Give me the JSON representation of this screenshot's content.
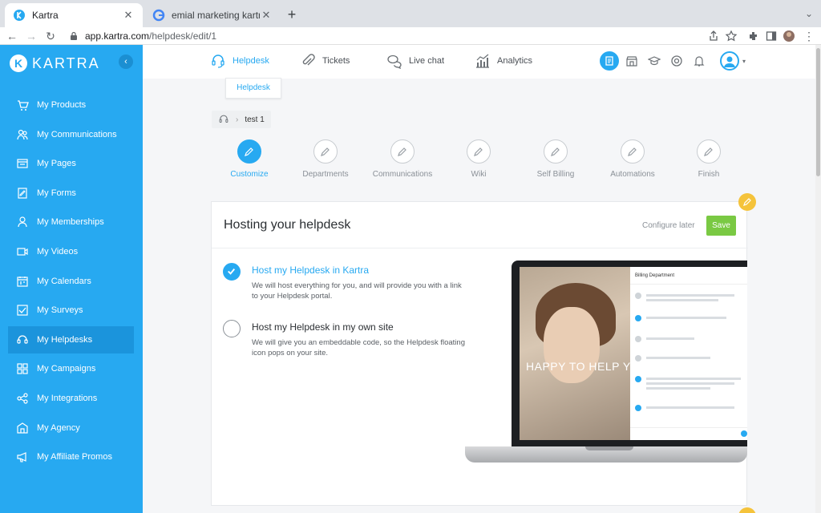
{
  "browser": {
    "tabs": [
      {
        "title": "Kartra",
        "favicon": "kartra-icon"
      },
      {
        "title": "emial marketing kartra - Googl",
        "favicon": "google-icon"
      }
    ],
    "new_tab_label": "+",
    "address": {
      "host": "app.kartra.com",
      "path": "/helpdesk/edit/1"
    }
  },
  "sidebar": {
    "brand": "KARTRA",
    "items": [
      {
        "label": "My Products",
        "icon": "cart-icon"
      },
      {
        "label": "My Communications",
        "icon": "people-icon"
      },
      {
        "label": "My Pages",
        "icon": "pages-icon"
      },
      {
        "label": "My Forms",
        "icon": "form-icon"
      },
      {
        "label": "My Memberships",
        "icon": "membership-icon"
      },
      {
        "label": "My Videos",
        "icon": "video-icon"
      },
      {
        "label": "My Calendars",
        "icon": "calendar-icon"
      },
      {
        "label": "My Surveys",
        "icon": "survey-icon"
      },
      {
        "label": "My Helpdesks",
        "icon": "headset-icon",
        "active": true
      },
      {
        "label": "My Campaigns",
        "icon": "campaign-icon"
      },
      {
        "label": "My Integrations",
        "icon": "integrations-icon"
      },
      {
        "label": "My Agency",
        "icon": "agency-icon"
      },
      {
        "label": "My Affiliate Promos",
        "icon": "megaphone-icon"
      }
    ]
  },
  "topnav": {
    "items": [
      {
        "label": "Helpdesk",
        "icon": "headset-icon",
        "active": true
      },
      {
        "label": "Tickets",
        "icon": "paperclip-icon"
      },
      {
        "label": "Live chat",
        "icon": "chat-icon"
      },
      {
        "label": "Analytics",
        "icon": "chart-icon"
      }
    ],
    "tooltip": "Helpdesk"
  },
  "breadcrumb": {
    "current": "test 1"
  },
  "steps": [
    {
      "label": "Customize",
      "active": true
    },
    {
      "label": "Departments"
    },
    {
      "label": "Communications"
    },
    {
      "label": "Wiki"
    },
    {
      "label": "Self Billing"
    },
    {
      "label": "Automations"
    },
    {
      "label": "Finish"
    }
  ],
  "card": {
    "title": "Hosting your helpdesk",
    "configure_later": "Configure later",
    "save": "Save",
    "options": [
      {
        "title": "Host my Helpdesk in Kartra",
        "description": "We will host everything for you, and will provide you with a link to your Helpdesk portal.",
        "selected": true
      },
      {
        "title": "Host my Helpdesk in my own site",
        "description": "We will give you an embeddable code, so the Helpdesk floating icon pops on your site.",
        "selected": false
      }
    ]
  },
  "illustration": {
    "photo_text": "HAPPY TO HELP YOU",
    "chat_header": "Billing Department"
  },
  "colors": {
    "brand": "#27a9f1",
    "save": "#7ac943",
    "edit": "#f5c33b"
  }
}
